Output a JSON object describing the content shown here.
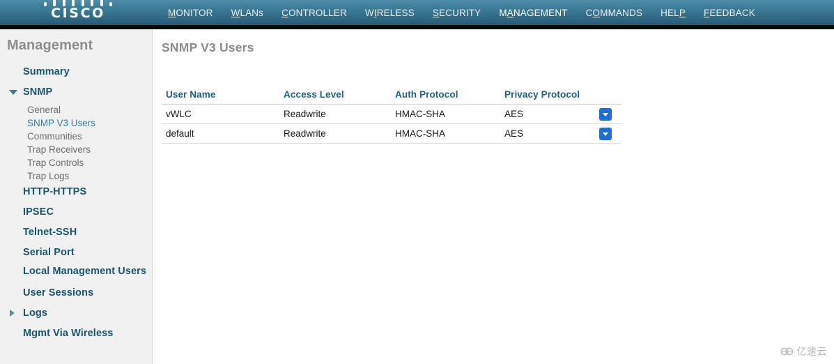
{
  "header": {
    "brand": "CISCO",
    "brand_icon": "cisco-logo",
    "active_accent_color": "#f49113",
    "nav": [
      {
        "label": "MONITOR",
        "accesskey": "M",
        "active": false
      },
      {
        "label": "WLANs",
        "accesskey": "W",
        "active": false
      },
      {
        "label": "CONTROLLER",
        "accesskey": "C",
        "active": false
      },
      {
        "label": "WIRELESS",
        "accesskey": "I",
        "active": false
      },
      {
        "label": "SECURITY",
        "accesskey": "S",
        "active": false
      },
      {
        "label": "MANAGEMENT",
        "accesskey": "A",
        "active": true
      },
      {
        "label": "COMMANDS",
        "accesskey": "O",
        "active": false
      },
      {
        "label": "HELP",
        "accesskey": "P",
        "active": false
      },
      {
        "label": "FEEDBACK",
        "accesskey": "F",
        "active": false
      }
    ]
  },
  "sidebar": {
    "title": "Management",
    "items": [
      {
        "label": "Summary",
        "type": "top",
        "expander": "none"
      },
      {
        "label": "SNMP",
        "type": "top",
        "expander": "expanded",
        "expander_icon": "triangle-down-icon"
      },
      {
        "label": "General",
        "type": "sub",
        "selected": false
      },
      {
        "label": "SNMP V3 Users",
        "type": "sub",
        "selected": true
      },
      {
        "label": "Communities",
        "type": "sub",
        "selected": false
      },
      {
        "label": "Trap Receivers",
        "type": "sub",
        "selected": false
      },
      {
        "label": "Trap Controls",
        "type": "sub",
        "selected": false
      },
      {
        "label": "Trap Logs",
        "type": "sub",
        "selected": false
      },
      {
        "label": "HTTP-HTTPS",
        "type": "top",
        "expander": "none"
      },
      {
        "label": "IPSEC",
        "type": "top",
        "expander": "none"
      },
      {
        "label": "Telnet-SSH",
        "type": "top",
        "expander": "none"
      },
      {
        "label": "Serial Port",
        "type": "top",
        "expander": "none"
      },
      {
        "label": "Local Management Users",
        "type": "top",
        "expander": "none",
        "multiline": true
      },
      {
        "label": "User Sessions",
        "type": "top",
        "expander": "none"
      },
      {
        "label": "Logs",
        "type": "top",
        "expander": "collapsed",
        "expander_icon": "triangle-right-icon"
      },
      {
        "label": "Mgmt Via Wireless",
        "type": "top",
        "expander": "none"
      }
    ]
  },
  "main": {
    "page_title": "SNMP V3 Users",
    "table": {
      "columns": [
        "User Name",
        "Access Level",
        "Auth Protocol",
        "Privacy Protocol",
        ""
      ],
      "rows": [
        {
          "user_name": "vWLC",
          "access_level": "Readwrite",
          "auth_protocol": "HMAC-SHA",
          "privacy_protocol": "AES",
          "action_icon": "dropdown-arrow-icon"
        },
        {
          "user_name": "default",
          "access_level": "Readwrite",
          "auth_protocol": "HMAC-SHA",
          "privacy_protocol": "AES",
          "action_icon": "dropdown-arrow-icon"
        }
      ]
    }
  },
  "watermark": {
    "text": "亿速云",
    "icon": "cloud-logo-icon"
  }
}
